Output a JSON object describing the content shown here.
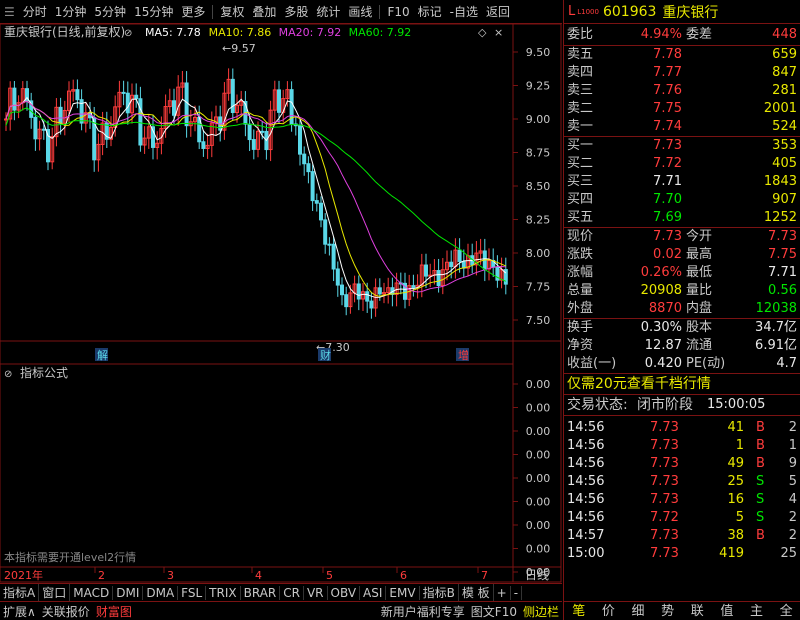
{
  "toolbar": {
    "items": [
      "分时",
      "1分钟",
      "5分钟",
      "15分钟",
      "更多",
      "复权",
      "叠加",
      "多股",
      "统计",
      "画线",
      "F10",
      "标记",
      "-自选",
      "返回"
    ]
  },
  "chart": {
    "title": "重庆银行(日线,前复权)",
    "ma": [
      {
        "label": "MA5: 7.78",
        "color": "#ffffff"
      },
      {
        "label": "MA10: 7.86",
        "color": "#e8e800"
      },
      {
        "label": "MA20: 7.92",
        "color": "#e040e0"
      },
      {
        "label": "MA60: 7.92",
        "color": "#00e600"
      }
    ],
    "y_ticks": [
      "9.50",
      "9.25",
      "9.00",
      "8.75",
      "8.50",
      "8.25",
      "8.00",
      "7.75",
      "7.50"
    ],
    "high_label": "9.57",
    "low_label": "7.30",
    "markers": [
      "解",
      "财",
      "增"
    ],
    "indicator_title": "指标公式",
    "indicator_ticks": [
      "0.00",
      "0.00",
      "0.00",
      "0.00",
      "0.00",
      "0.00",
      "0.00",
      "0.00",
      "0.00"
    ],
    "indicator_note": "本指标需要开通level2行情",
    "x_year": "2021年",
    "x_months": [
      "2",
      "3",
      "4",
      "5",
      "6",
      "7"
    ],
    "period": "日线"
  },
  "tabs": [
    "指标A",
    "窗口",
    "MACD",
    "DMI",
    "DMA",
    "FSL",
    "TRIX",
    "BRAR",
    "CR",
    "VR",
    "OBV",
    "ASI",
    "EMV",
    "指标B",
    "模 板",
    "+",
    "-"
  ],
  "bottom": [
    "扩展∧",
    "关联报价",
    "财富图",
    "新用户福利专享",
    "图文F10",
    "侧边栏"
  ],
  "stock": {
    "flag": "L",
    "code": "601963",
    "name": "重庆银行"
  },
  "weibi": {
    "label": "委比",
    "value": "4.94%",
    "label2": "委差",
    "value2": "448"
  },
  "sells": [
    {
      "label": "卖五",
      "price": "7.78",
      "vol": "659"
    },
    {
      "label": "卖四",
      "price": "7.77",
      "vol": "847"
    },
    {
      "label": "卖三",
      "price": "7.76",
      "vol": "281"
    },
    {
      "label": "卖二",
      "price": "7.75",
      "vol": "2001"
    },
    {
      "label": "卖一",
      "price": "7.74",
      "vol": "524"
    }
  ],
  "buys": [
    {
      "label": "买一",
      "price": "7.73",
      "vol": "353",
      "pc": "red"
    },
    {
      "label": "买二",
      "price": "7.72",
      "vol": "405",
      "pc": "red"
    },
    {
      "label": "买三",
      "price": "7.71",
      "vol": "1843",
      "pc": "wht"
    },
    {
      "label": "买四",
      "price": "7.70",
      "vol": "907",
      "pc": "grn"
    },
    {
      "label": "买五",
      "price": "7.69",
      "vol": "1252",
      "pc": "grn"
    }
  ],
  "quote": [
    {
      "l1": "现价",
      "v1": "7.73",
      "c1": "red",
      "l2": "今开",
      "v2": "7.73",
      "c2": "red"
    },
    {
      "l1": "涨跌",
      "v1": "0.02",
      "c1": "red",
      "l2": "最高",
      "v2": "7.75",
      "c2": "red"
    },
    {
      "l1": "涨幅",
      "v1": "0.26%",
      "c1": "red",
      "l2": "最低",
      "v2": "7.71",
      "c2": "wht"
    },
    {
      "l1": "总量",
      "v1": "20908",
      "c1": "yel",
      "l2": "量比",
      "v2": "0.56",
      "c2": "grn"
    },
    {
      "l1": "外盘",
      "v1": "8870",
      "c1": "red",
      "l2": "内盘",
      "v2": "12038",
      "c2": "grn"
    }
  ],
  "fin": [
    {
      "l1": "换手",
      "v1": "0.30%",
      "l2": "股本",
      "v2": "34.7亿"
    },
    {
      "l1": "净资",
      "v1": "12.87",
      "l2": "流通",
      "v2": "6.91亿"
    },
    {
      "l1": "收益(一)",
      "v1": "0.420",
      "l2": "PE(动)",
      "v2": "4.7"
    }
  ],
  "promo": "仅需20元查看千档行情",
  "trade_status": {
    "label": "交易状态:",
    "value": "闭市阶段",
    "time": "15:00:05"
  },
  "ticks": [
    {
      "t": "14:56",
      "p": "7.73",
      "v": "41",
      "s": "B",
      "n": "2"
    },
    {
      "t": "14:56",
      "p": "7.73",
      "v": "1",
      "s": "B",
      "n": "1"
    },
    {
      "t": "14:56",
      "p": "7.73",
      "v": "49",
      "s": "B",
      "n": "9"
    },
    {
      "t": "14:56",
      "p": "7.73",
      "v": "25",
      "s": "S",
      "n": "5"
    },
    {
      "t": "14:56",
      "p": "7.73",
      "v": "16",
      "s": "S",
      "n": "4"
    },
    {
      "t": "14:56",
      "p": "7.72",
      "v": "5",
      "s": "S",
      "n": "2"
    },
    {
      "t": "14:57",
      "p": "7.73",
      "v": "38",
      "s": "B",
      "n": "2"
    },
    {
      "t": "15:00",
      "p": "7.73",
      "v": "419",
      "s": "",
      "n": "25"
    }
  ],
  "rtabs": [
    "笔",
    "价",
    "细",
    "势",
    "联",
    "值",
    "主",
    "全"
  ]
}
